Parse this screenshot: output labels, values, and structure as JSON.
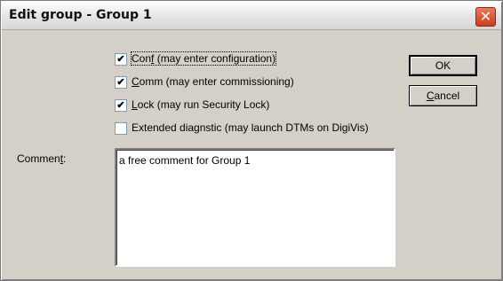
{
  "window": {
    "title": "Edit group - Group 1",
    "close_glyph": "✕"
  },
  "checkboxes": [
    {
      "label_pre": "Con",
      "label_key": "f",
      "label_post": " (may enter configuration)",
      "checked": true
    },
    {
      "label_pre": "",
      "label_key": "C",
      "label_post": "omm (may enter commissioning)",
      "checked": true
    },
    {
      "label_pre": "",
      "label_key": "L",
      "label_post": "ock (may run Security Lock)",
      "checked": true
    },
    {
      "label_pre": "",
      "label_key": "",
      "label_post": "Extended diagnstic (may launch DTMs on DigiVis)",
      "checked": false
    }
  ],
  "check_glyph": "✔",
  "buttons": {
    "ok_label": "OK",
    "cancel_key": "C",
    "cancel_rest": "ancel"
  },
  "comment": {
    "label_pre": "Commen",
    "label_key": "t",
    "label_post": ":",
    "value": "a free comment for Group 1"
  }
}
